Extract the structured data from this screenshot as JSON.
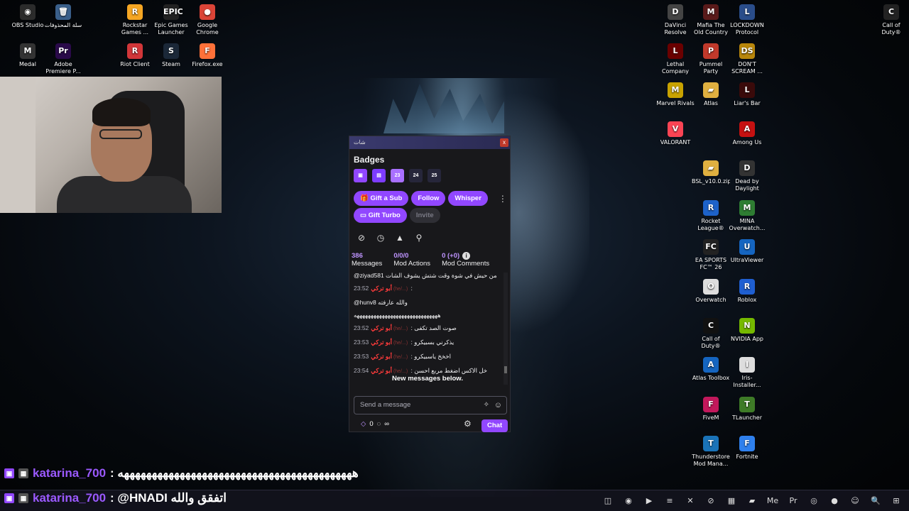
{
  "desktop": {
    "left_icons": [
      {
        "label": "OBS Studio",
        "glyph": "◉",
        "color": "#2b2b2b"
      },
      {
        "label": "سلة المحذوفات",
        "glyph": "🗑",
        "color": "#3a5f8a"
      },
      {
        "label": "Rockstar Games ...",
        "glyph": "R",
        "color": "#f5a623"
      },
      {
        "label": "Epic Games Launcher",
        "glyph": "EPIC",
        "color": "#222"
      },
      {
        "label": "Google Chrome",
        "glyph": "●",
        "color": "#db4437"
      },
      {
        "label": "Medal",
        "glyph": "M",
        "color": "#333"
      },
      {
        "label": "Adobe Premiere P...",
        "glyph": "Pr",
        "color": "#2a0a4a"
      },
      {
        "label": "Riot Client",
        "glyph": "R",
        "color": "#d13639"
      },
      {
        "label": "Steam",
        "glyph": "S",
        "color": "#1b2838"
      },
      {
        "label": "Firefox.exe",
        "glyph": "F",
        "color": "#ff7139"
      }
    ],
    "right_icons": [
      {
        "label": "DaVinci Resolve",
        "glyph": "D",
        "color": "#444"
      },
      {
        "label": "Mafia The Old Country",
        "glyph": "M",
        "color": "#5a1a1a"
      },
      {
        "label": "LOCKDOWN Protocol",
        "glyph": "L",
        "color": "#2a4d8a"
      },
      {
        "label": "Call of Duty®",
        "glyph": "C",
        "color": "#222"
      },
      {
        "label": "Lethal Company",
        "glyph": "L",
        "color": "#6a0000"
      },
      {
        "label": "Pummel Party",
        "glyph": "P",
        "color": "#c0392b"
      },
      {
        "label": "DON'T SCREAM ...",
        "glyph": "DS",
        "color": "#b8860b"
      },
      {
        "label": "Marvel Rivals",
        "glyph": "M",
        "color": "#c8a200"
      },
      {
        "label": "Atlas",
        "glyph": "▰",
        "color": "#e0b040"
      },
      {
        "label": "Liar's Bar",
        "glyph": "L",
        "color": "#3a0a0a"
      },
      {
        "label": "VALORANT",
        "glyph": "V",
        "color": "#fa4454"
      },
      {
        "label": "Among Us",
        "glyph": "A",
        "color": "#c51111"
      },
      {
        "label": "BSL_v10.0.zip",
        "glyph": "▰",
        "color": "#e0b040"
      },
      {
        "label": "Dead by Daylight",
        "glyph": "D",
        "color": "#333"
      },
      {
        "label": "Rocket League®",
        "glyph": "R",
        "color": "#1d62c9"
      },
      {
        "label": "MINA Overwatch...",
        "glyph": "M",
        "color": "#2e7d32"
      },
      {
        "label": "EA SPORTS FC™ 26",
        "glyph": "FC",
        "color": "#222"
      },
      {
        "label": "UltraViewer",
        "glyph": "U",
        "color": "#1565c0"
      },
      {
        "label": "Overwatch",
        "glyph": "O",
        "color": "#ddd"
      },
      {
        "label": "Roblox",
        "glyph": "R",
        "color": "#1f5fd1"
      },
      {
        "label": "Call of Duty®",
        "glyph": "C",
        "color": "#111"
      },
      {
        "label": "NVIDIA App",
        "glyph": "N",
        "color": "#76b900"
      },
      {
        "label": "Atlas Toolbox",
        "glyph": "A",
        "color": "#1565c0"
      },
      {
        "label": "Iris-Installer...",
        "glyph": "I",
        "color": "#ddd"
      },
      {
        "label": "FiveM",
        "glyph": "F",
        "color": "#c2185b"
      },
      {
        "label": "TLauncher",
        "glyph": "T",
        "color": "#3e7b27"
      },
      {
        "label": "Thunderstore Mod Mana...",
        "glyph": "T",
        "color": "#1a73b8"
      },
      {
        "label": "Fortnite",
        "glyph": "F",
        "color": "#2f80ed"
      }
    ]
  },
  "chat_window": {
    "title": "شات",
    "close": "x",
    "badges_title": "Badges",
    "badges": [
      {
        "text": "▣",
        "bg": "#9147ff"
      },
      {
        "text": "▤",
        "bg": "#7d3cff"
      },
      {
        "text": "23",
        "bg": "#a970ff"
      },
      {
        "text": "24",
        "bg": "#26263a"
      },
      {
        "text": "25",
        "bg": "#26263a"
      }
    ],
    "buttons": {
      "gift_sub": "Gift a Sub",
      "follow": "Follow",
      "whisper": "Whisper",
      "more": "⋮",
      "gift_turbo": "Gift Turbo",
      "invite": "Invite"
    },
    "mod_icons": [
      "ban-icon",
      "timeout-icon",
      "warning-icon",
      "add-mod-icon"
    ],
    "stats": {
      "messages_num": "386",
      "messages_label": "Messages",
      "mod_actions_num": "0/0/0",
      "mod_actions_label": "Mod Actions",
      "mod_comments_num": "0 (+0)",
      "mod_comments_label": "Mod Comments"
    },
    "messages": [
      {
        "time": "",
        "user": "",
        "pronoun": "",
        "text": "@ziyad581  من حيش في شوة وقت شتش يشوف الشات"
      },
      {
        "time": "23:52",
        "user": "أبو تركي",
        "pronoun": "(he/...)",
        "text": ":"
      },
      {
        "time": "",
        "user": "",
        "pronoun": "",
        "text": "@hunv8 والله عارفته"
      },
      {
        "time": "",
        "user": "",
        "pronoun": "",
        "text": "ههههههههههههههههههههههههههههههه"
      },
      {
        "time": "23:52",
        "user": "أبو تركي",
        "pronoun": "(he/...)",
        "text": ": صوت الصد تكفى"
      },
      {
        "time": "23:53",
        "user": "أبو تركي",
        "pronoun": "(he/...)",
        "text": ": يذكرني بسبيكرو"
      },
      {
        "time": "23:53",
        "user": "أبو تركي",
        "pronoun": "(he/...)",
        "text": ": اخخخ ياسبيكرو"
      },
      {
        "time": "23:54",
        "user": "أبو تركي",
        "pronoun": "(he/...)",
        "text": ": خل الاكس اضغط مربع احسن"
      }
    ],
    "new_messages": "New messages below.",
    "input_placeholder": "Send a message",
    "points": "0",
    "infinity": "∞",
    "chat_button": "Chat"
  },
  "overlay": {
    "line1_user": "katarina_700",
    "line1_text": ": ههههههههههههههههههههههههههههههههههههههههههه",
    "line2_user": "katarina_700",
    "line2_text": ": @HNADI اتفقق والله"
  },
  "taskbar": {
    "icons": [
      "◫",
      "◉",
      "▶",
      "≡",
      "✕",
      "⊘",
      "▦",
      "▰",
      "Me",
      "Pr",
      "◎",
      "●",
      "☺",
      "🔍",
      "⊞"
    ]
  }
}
